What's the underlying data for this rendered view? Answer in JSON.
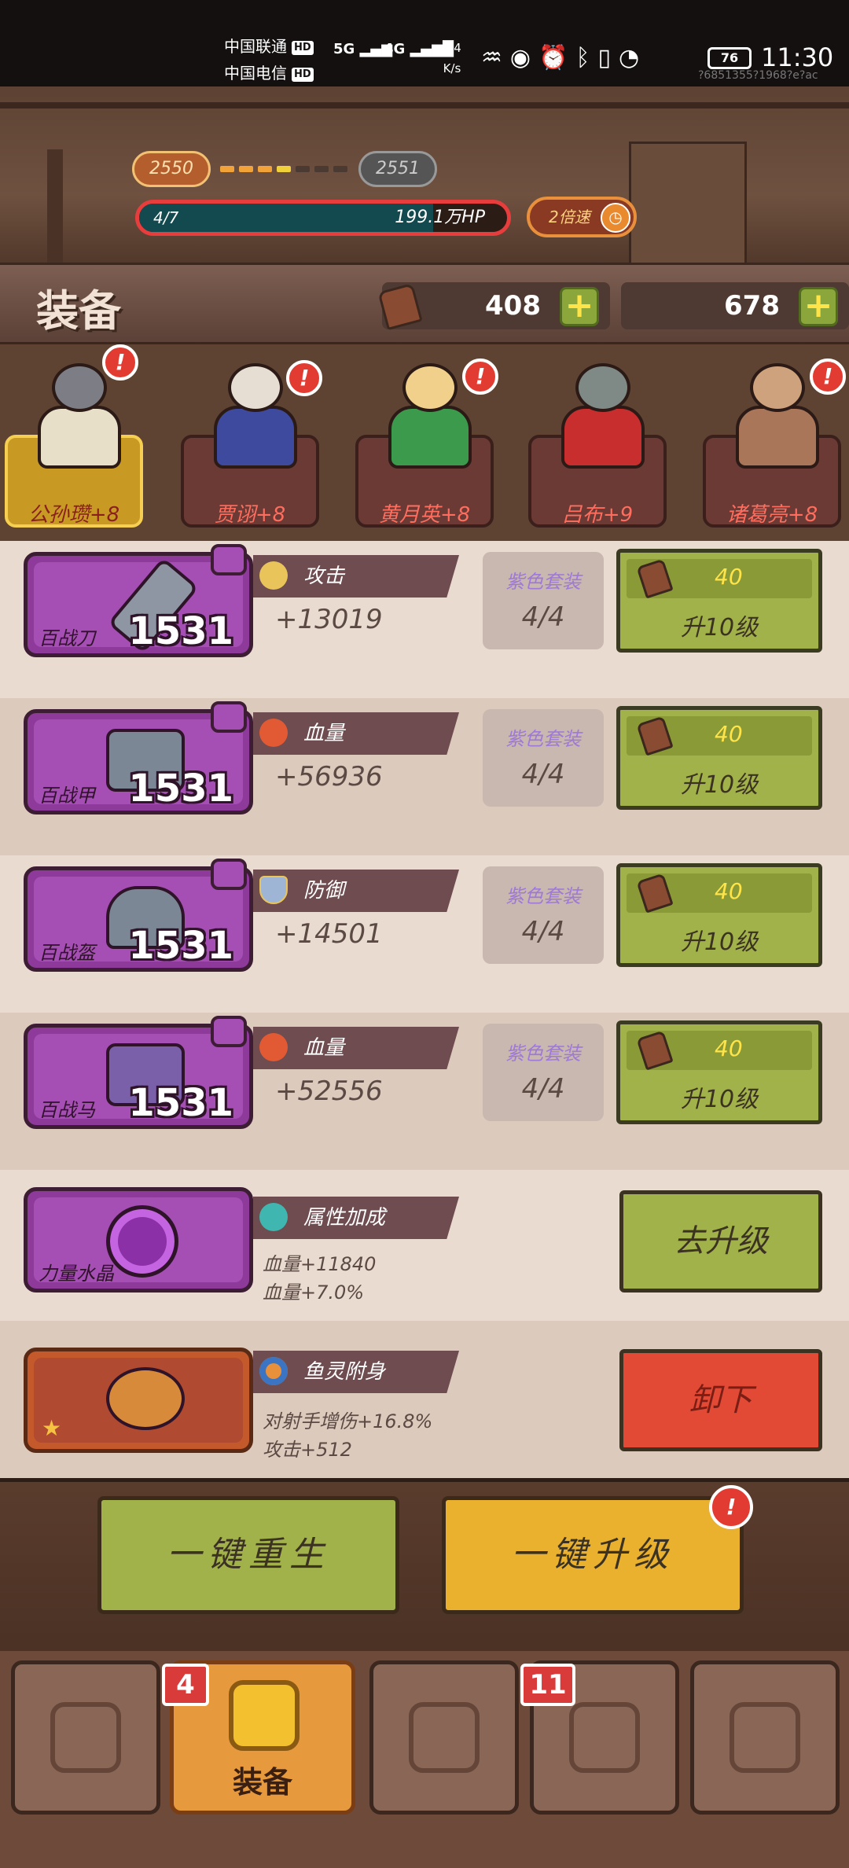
{
  "status_bar": {
    "carrier1": "中国联通",
    "carrier2": "中国电信",
    "hd": "HD",
    "net1": "5G",
    "net2": "4G",
    "speed_value": "6.4",
    "speed_unit": "K/s",
    "battery": "76",
    "time": "11:30",
    "device_id": "?6851355?1968?e?ac"
  },
  "stage": {
    "current_level": "2550",
    "next_level": "2551",
    "wave": "4/7",
    "boss_hp": "199.1万HP",
    "boss_hp_fraction": 0.8,
    "speed_label": "2倍速",
    "speed_icon": "clock-icon"
  },
  "header": {
    "title": "装备",
    "resources": [
      {
        "icon": "coffin-coin-icon",
        "value": "408",
        "plus": "+"
      },
      {
        "icon": "blank-resource-icon",
        "value": "678",
        "plus": "+"
      }
    ]
  },
  "heroes": [
    {
      "name": "公孙瓒+8",
      "selected": true,
      "alert": "!"
    },
    {
      "name": "贾诩+8",
      "selected": false,
      "alert": "!"
    },
    {
      "name": "黄月英+8",
      "selected": false,
      "alert": "!"
    },
    {
      "name": "吕布+9",
      "selected": false,
      "alert": ""
    },
    {
      "name": "诸葛亮+8",
      "selected": false,
      "alert": "!"
    }
  ],
  "equipment": [
    {
      "item_name": "百战刀",
      "level": "1531",
      "stat_icon": "sword-icon",
      "stat_name": "攻击",
      "stat_value": "+13019",
      "set_label": "紫色套装",
      "set_count": "4/4",
      "cost": "40",
      "upgrade_label": "升10级"
    },
    {
      "item_name": "百战甲",
      "level": "1531",
      "stat_icon": "blood-drop-icon",
      "stat_name": "血量",
      "stat_value": "+56936",
      "set_label": "紫色套装",
      "set_count": "4/4",
      "cost": "40",
      "upgrade_label": "升10级"
    },
    {
      "item_name": "百战盔",
      "level": "1531",
      "stat_icon": "shield-icon",
      "stat_name": "防御",
      "stat_value": "+14501",
      "set_label": "紫色套装",
      "set_count": "4/4",
      "cost": "40",
      "upgrade_label": "升10级"
    },
    {
      "item_name": "百战马",
      "level": "1531",
      "stat_icon": "blood-drop-icon",
      "stat_name": "血量",
      "stat_value": "+52556",
      "set_label": "紫色套装",
      "set_count": "4/4",
      "cost": "40",
      "upgrade_label": "升10级"
    }
  ],
  "crystal": {
    "item_name": "力量水晶",
    "tag": "属性加成",
    "tag_icon": "crystal-icon",
    "bonus1": "血量+11840",
    "bonus2": "血量+7.0%",
    "button": "去升级"
  },
  "spirit": {
    "tag": "鱼灵附身",
    "tag_icon": "fish-orb-icon",
    "bonus1": "对射手增伤+16.8%",
    "bonus2": "攻击+512",
    "button": "卸下"
  },
  "actions": {
    "rebirth": "一键重生",
    "upgrade_all": "一键升级",
    "alert": "!"
  },
  "tabs": [
    {
      "label": "",
      "icon": "horse-tab-icon",
      "badge": ""
    },
    {
      "label": "装备",
      "icon": "armor-tab-icon",
      "badge": "4"
    },
    {
      "label": "",
      "icon": "helmet-tab-icon",
      "badge": ""
    },
    {
      "label": "",
      "icon": "chest-tab-icon",
      "badge": "11"
    },
    {
      "label": "",
      "icon": "scroll-tab-icon",
      "badge": ""
    }
  ],
  "colors": {
    "purple_card": "#a54eb4",
    "green_button": "#a2b24b",
    "red_button": "#e24a35",
    "yellow_button": "#eab12f",
    "hp_border": "#e73d3d"
  }
}
